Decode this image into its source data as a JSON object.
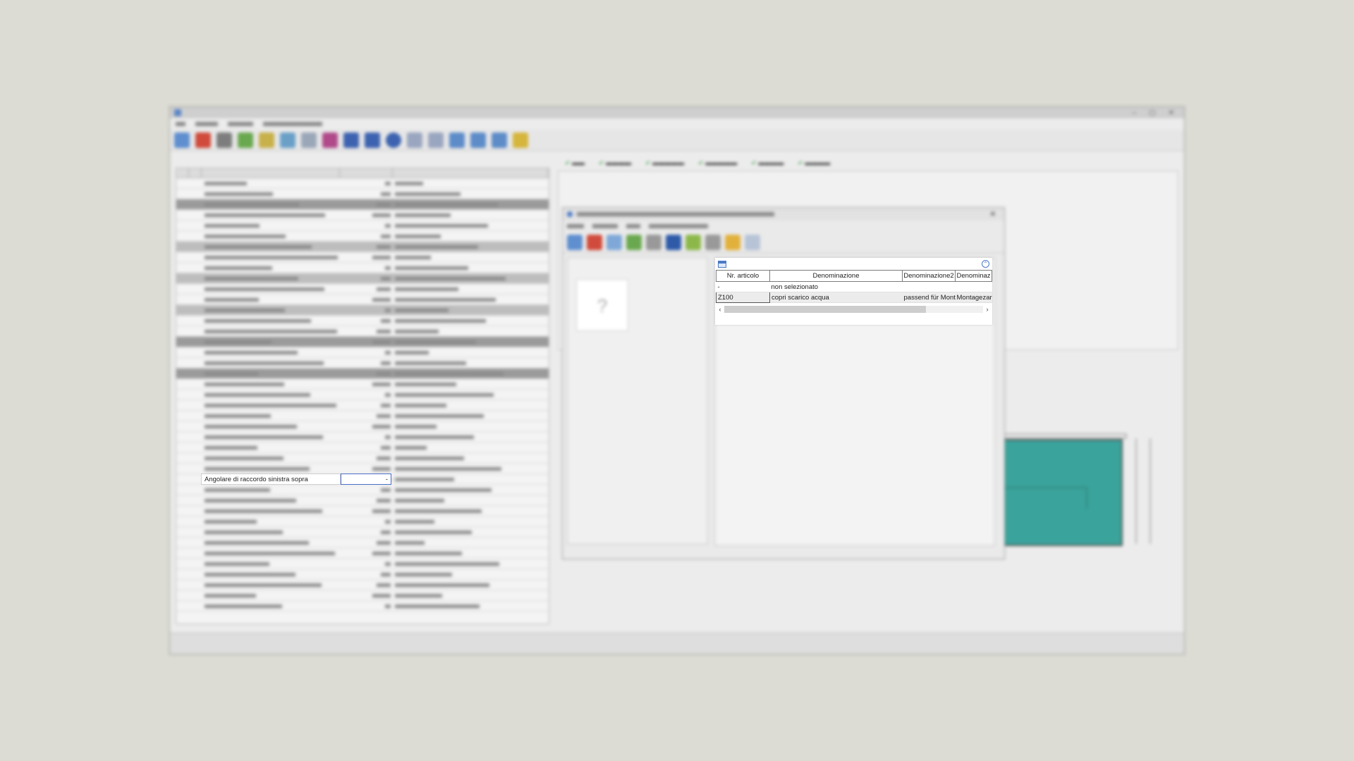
{
  "focused_cell": {
    "label": "Angolare di raccordo sinistra sopra",
    "value": "-"
  },
  "lookup": {
    "columns": [
      "Nr. articolo",
      "Denominazione",
      "Denominazione2",
      "Denominaz"
    ],
    "rows": [
      [
        "-",
        "non selezionato",
        "",
        ""
      ],
      [
        "Z100",
        "copri scarico acqua",
        "passend für Mont",
        "Montagezar"
      ]
    ],
    "selected_row": 1
  },
  "colors": {
    "desktop": "#dcdcd4",
    "selection_border": "#4a6fc9",
    "drawing_fill": "#3aa39b"
  }
}
